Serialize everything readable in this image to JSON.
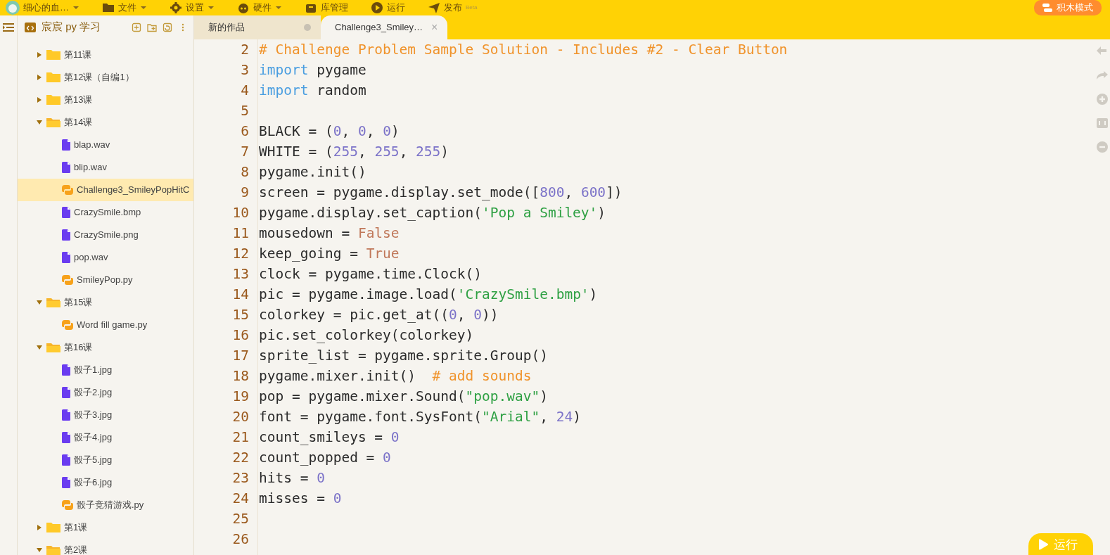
{
  "menu_bar": {
    "user": {
      "label": "细心的血…",
      "dropdown": true
    },
    "items": [
      {
        "label": "文件",
        "dropdown": true
      },
      {
        "label": "设置",
        "dropdown": true
      },
      {
        "label": "硬件",
        "dropdown": true
      },
      {
        "label": "库管理",
        "dropdown": false
      },
      {
        "label": "运行",
        "dropdown": false
      },
      {
        "label": "发布",
        "dropdown": false,
        "badge": "Beta"
      }
    ],
    "mode_button": "积木模式"
  },
  "sidebar": {
    "title": "宸宸 py 学习",
    "items": [
      {
        "label": "第11课",
        "kind": "folder",
        "expanded": false,
        "selected": false
      },
      {
        "label": "第12课（自编1）",
        "kind": "folder",
        "expanded": false,
        "selected": false
      },
      {
        "label": "第13课",
        "kind": "folder",
        "expanded": false,
        "selected": false
      },
      {
        "label": "第14课",
        "kind": "folder",
        "expanded": true,
        "selected": false,
        "children": [
          {
            "label": "blap.wav",
            "kind": "file",
            "selected": false
          },
          {
            "label": "blip.wav",
            "kind": "file",
            "selected": false
          },
          {
            "label": "Challenge3_SmileyPopHitC",
            "kind": "python",
            "selected": true
          },
          {
            "label": "CrazySmile.bmp",
            "kind": "file",
            "selected": false
          },
          {
            "label": "CrazySmile.png",
            "kind": "file",
            "selected": false
          },
          {
            "label": "pop.wav",
            "kind": "file",
            "selected": false
          },
          {
            "label": "SmileyPop.py",
            "kind": "python",
            "selected": false
          }
        ]
      },
      {
        "label": "第15课",
        "kind": "folder",
        "expanded": true,
        "selected": false,
        "children": [
          {
            "label": "Word fill game.py",
            "kind": "python",
            "selected": false
          }
        ]
      },
      {
        "label": "第16课",
        "kind": "folder",
        "expanded": true,
        "selected": false,
        "children": [
          {
            "label": "骰子1.jpg",
            "kind": "file",
            "selected": false
          },
          {
            "label": "骰子2.jpg",
            "kind": "file",
            "selected": false
          },
          {
            "label": "骰子3.jpg",
            "kind": "file",
            "selected": false
          },
          {
            "label": "骰子4.jpg",
            "kind": "file",
            "selected": false
          },
          {
            "label": "骰子5.jpg",
            "kind": "file",
            "selected": false
          },
          {
            "label": "骰子6.jpg",
            "kind": "file",
            "selected": false
          },
          {
            "label": "骰子竞猜游戏.py",
            "kind": "python",
            "selected": false
          }
        ]
      },
      {
        "label": "第1课",
        "kind": "folder",
        "expanded": false,
        "selected": false
      },
      {
        "label": "第2课",
        "kind": "folder",
        "expanded": true,
        "selected": false
      }
    ]
  },
  "tabs": [
    {
      "label": "新的作品",
      "selected": false,
      "unsaved": true
    },
    {
      "label": "Challenge3_Smiley…",
      "selected": true,
      "unsaved": false,
      "close": "×"
    }
  ],
  "editor": {
    "lines": [
      {
        "number": "2",
        "tokens": [
          {
            "t": "# Challenge Problem Sample Solution - Includes #2 - Clear Button",
            "kind": "comment"
          }
        ]
      },
      {
        "number": "3",
        "tokens": [
          {
            "t": "import",
            "kind": "keyword"
          },
          {
            "t": " pygame",
            "kind": "plain"
          }
        ]
      },
      {
        "number": "4",
        "tokens": [
          {
            "t": "import",
            "kind": "keyword"
          },
          {
            "t": " random",
            "kind": "plain"
          }
        ]
      },
      {
        "number": "5"
      },
      {
        "number": "6",
        "tokens": [
          {
            "t": "BLACK = (",
            "kind": "plain"
          },
          {
            "t": "0",
            "kind": "number"
          },
          {
            "t": ", ",
            "kind": "plain"
          },
          {
            "t": "0",
            "kind": "number"
          },
          {
            "t": ", ",
            "kind": "plain"
          },
          {
            "t": "0",
            "kind": "number"
          },
          {
            "t": ")",
            "kind": "plain"
          }
        ]
      },
      {
        "number": "7",
        "tokens": [
          {
            "t": "WHITE = (",
            "kind": "plain"
          },
          {
            "t": "255",
            "kind": "number"
          },
          {
            "t": ", ",
            "kind": "plain"
          },
          {
            "t": "255",
            "kind": "number"
          },
          {
            "t": ", ",
            "kind": "plain"
          },
          {
            "t": "255",
            "kind": "number"
          },
          {
            "t": ")",
            "kind": "plain"
          }
        ]
      },
      {
        "number": "8",
        "tokens": [
          {
            "t": "pygame.init()",
            "kind": "plain"
          }
        ]
      },
      {
        "number": "9",
        "tokens": [
          {
            "t": "screen = pygame.display.set_mode([",
            "kind": "plain"
          },
          {
            "t": "800",
            "kind": "number"
          },
          {
            "t": ", ",
            "kind": "plain"
          },
          {
            "t": "600",
            "kind": "number"
          },
          {
            "t": "])",
            "kind": "plain"
          }
        ]
      },
      {
        "number": "10",
        "tokens": [
          {
            "t": "pygame.display.set_caption(",
            "kind": "plain"
          },
          {
            "t": "'Pop a Smiley'",
            "kind": "string"
          },
          {
            "t": ")",
            "kind": "plain"
          }
        ]
      },
      {
        "number": "11",
        "tokens": [
          {
            "t": "mousedown = ",
            "kind": "plain"
          },
          {
            "t": "False",
            "kind": "constant"
          }
        ]
      },
      {
        "number": "12",
        "tokens": [
          {
            "t": "keep_going = ",
            "kind": "plain"
          },
          {
            "t": "True",
            "kind": "constant"
          }
        ]
      },
      {
        "number": "13",
        "tokens": [
          {
            "t": "clock = pygame.time.Clock()",
            "kind": "plain"
          }
        ]
      },
      {
        "number": "14",
        "tokens": [
          {
            "t": "pic = pygame.image.load(",
            "kind": "plain"
          },
          {
            "t": "'CrazySmile.bmp'",
            "kind": "string"
          },
          {
            "t": ")",
            "kind": "plain"
          }
        ]
      },
      {
        "number": "15",
        "tokens": [
          {
            "t": "colorkey = pic.get_at((",
            "kind": "plain"
          },
          {
            "t": "0",
            "kind": "number"
          },
          {
            "t": ", ",
            "kind": "plain"
          },
          {
            "t": "0",
            "kind": "number"
          },
          {
            "t": "))",
            "kind": "plain"
          }
        ]
      },
      {
        "number": "16",
        "tokens": [
          {
            "t": "pic.set_colorkey(colorkey)",
            "kind": "plain"
          }
        ]
      },
      {
        "number": "17",
        "tokens": [
          {
            "t": "sprite_list = pygame.sprite.Group()",
            "kind": "plain"
          }
        ]
      },
      {
        "number": "18",
        "tokens": [
          {
            "t": "pygame.mixer.init()  ",
            "kind": "plain"
          },
          {
            "t": "# add sounds",
            "kind": "comment"
          }
        ]
      },
      {
        "number": "19",
        "tokens": [
          {
            "t": "pop = pygame.mixer.Sound(",
            "kind": "plain"
          },
          {
            "t": "\"pop.wav\"",
            "kind": "string"
          },
          {
            "t": ")",
            "kind": "plain"
          }
        ]
      },
      {
        "number": "20",
        "tokens": [
          {
            "t": "font = pygame.font.SysFont(",
            "kind": "plain"
          },
          {
            "t": "\"Arial\"",
            "kind": "string"
          },
          {
            "t": ", ",
            "kind": "plain"
          },
          {
            "t": "24",
            "kind": "number"
          },
          {
            "t": ")",
            "kind": "plain"
          }
        ]
      },
      {
        "number": "21",
        "tokens": [
          {
            "t": "count_smileys = ",
            "kind": "plain"
          },
          {
            "t": "0",
            "kind": "number"
          }
        ]
      },
      {
        "number": "22",
        "tokens": [
          {
            "t": "count_popped = ",
            "kind": "plain"
          },
          {
            "t": "0",
            "kind": "number"
          }
        ]
      },
      {
        "number": "23",
        "tokens": [
          {
            "t": "hits = ",
            "kind": "plain"
          },
          {
            "t": "0",
            "kind": "number"
          }
        ]
      },
      {
        "number": "24",
        "tokens": [
          {
            "t": "misses = ",
            "kind": "plain"
          },
          {
            "t": "0",
            "kind": "number"
          }
        ]
      },
      {
        "number": "25"
      },
      {
        "number": "26"
      }
    ]
  },
  "run_button": "运行"
}
